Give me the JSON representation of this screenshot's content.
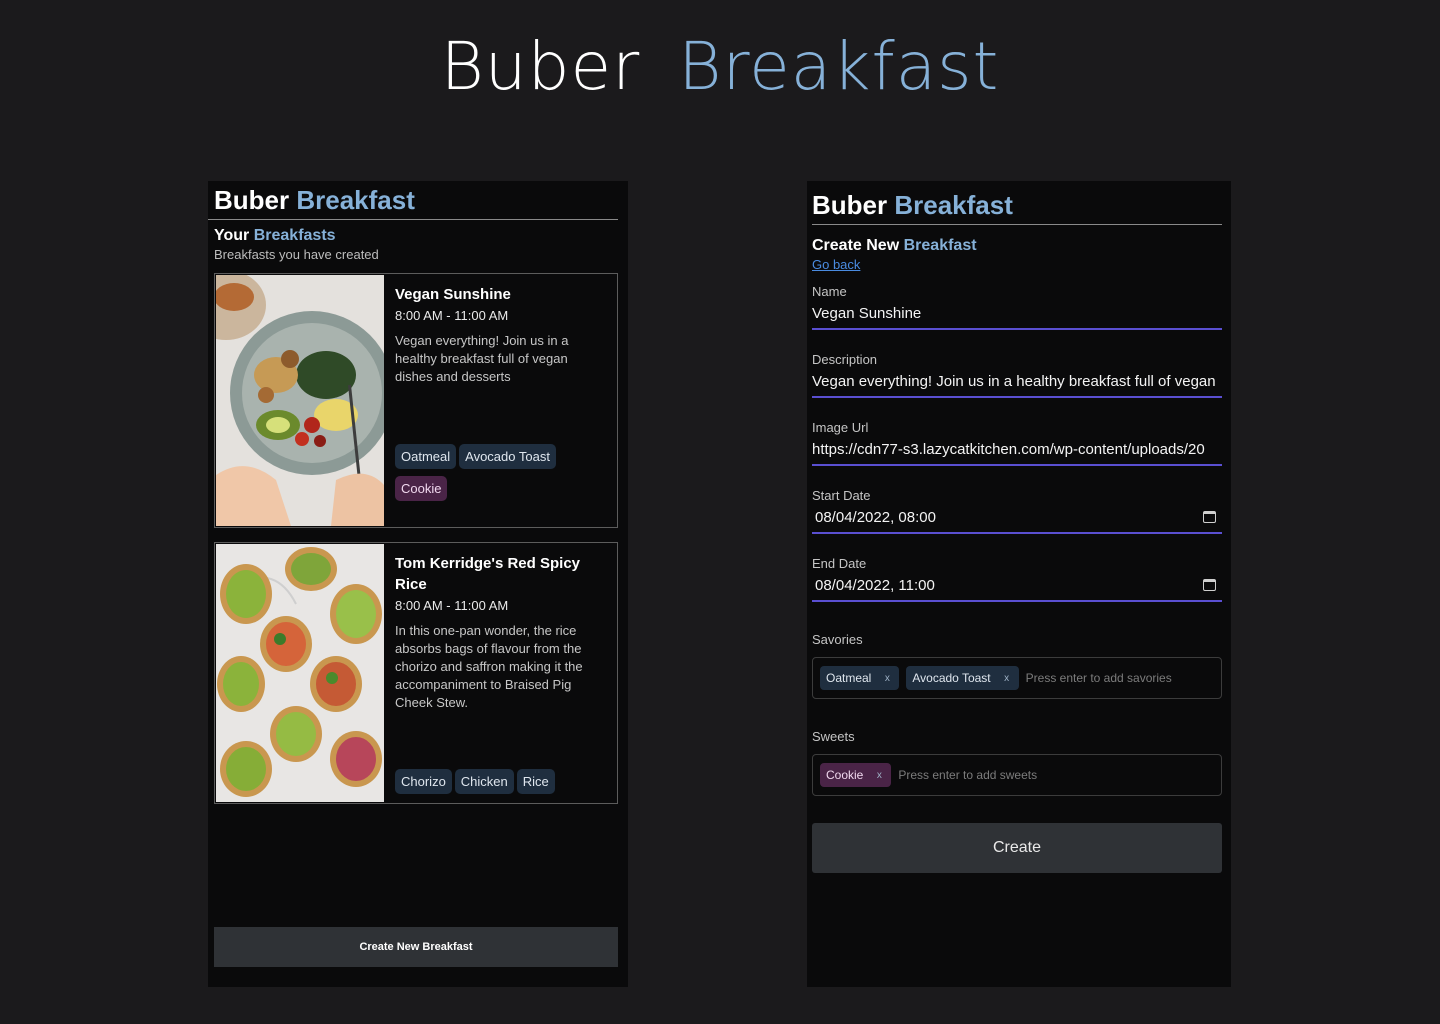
{
  "hero": {
    "word1": "Buber",
    "word2": "Breakfast"
  },
  "left": {
    "brand": {
      "b1": "Buber",
      "b2": "Breakfast"
    },
    "section": {
      "t1": "Your",
      "t2": "Breakfasts",
      "subtitle": "Breakfasts you have created"
    },
    "cards": [
      {
        "name": "Vegan Sunshine",
        "time": "8:00 AM - 11:00 AM",
        "description": "Vegan everything! Join us in a healthy breakfast full of vegan dishes and desserts",
        "savories": [
          "Oatmeal",
          "Avocado Toast"
        ],
        "sweets": [
          "Cookie"
        ]
      },
      {
        "name": "Tom Kerridge's Red Spicy Rice",
        "time": "8:00 AM - 11:00 AM",
        "description": "In this one-pan wonder, the rice absorbs bags of flavour from the chorizo and saffron making it the accompaniment to Braised Pig Cheek Stew.",
        "savories": [
          "Chorizo",
          "Chicken",
          "Rice"
        ],
        "sweets": []
      }
    ],
    "create_button": "Create New Breakfast"
  },
  "right": {
    "brand": {
      "b1": "Buber",
      "b2": "Breakfast"
    },
    "section": {
      "t1": "Create New",
      "t2": "Breakfast"
    },
    "go_back": "Go back",
    "fields": {
      "name": {
        "label": "Name",
        "value": "Vegan Sunshine"
      },
      "description": {
        "label": "Description",
        "value": "Vegan everything! Join us in a healthy breakfast full of vegan"
      },
      "image_url": {
        "label": "Image Url",
        "value": "https://cdn77-s3.lazycatkitchen.com/wp-content/uploads/20"
      },
      "start_date": {
        "label": "Start Date",
        "value": "08/04/2022, 08:00"
      },
      "end_date": {
        "label": "End Date",
        "value": "08/04/2022, 11:00"
      }
    },
    "savories": {
      "label": "Savories",
      "chips": [
        "Oatmeal",
        "Avocado Toast"
      ],
      "placeholder": "Press enter to add savories"
    },
    "sweets": {
      "label": "Sweets",
      "chips": [
        "Cookie"
      ],
      "placeholder": "Press enter to add sweets"
    },
    "chip_remove": "x",
    "create_button": "Create"
  },
  "colors": {
    "accent_blue": "#86b1d8",
    "underline_purple": "#5a4fd1",
    "savory_tag": "#1f2e3f",
    "sweet_tag": "#4a2447"
  }
}
